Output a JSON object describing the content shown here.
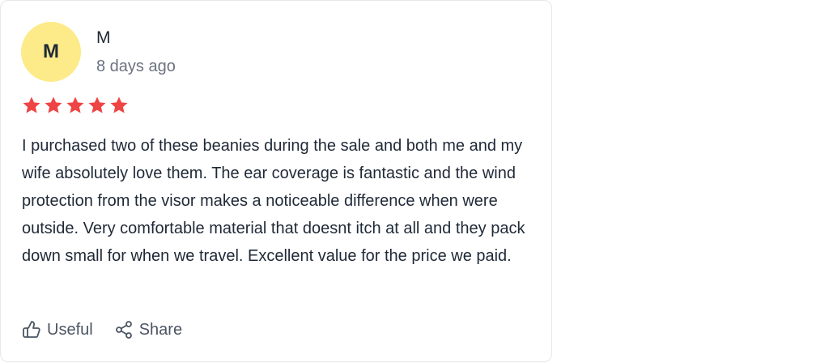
{
  "review": {
    "avatar_initial": "M",
    "author": "M",
    "date": "8 days ago",
    "rating": 5,
    "rating_max": 5,
    "body": "I purchased two of these beanies during the sale and both me and my wife absolutely love them. The ear coverage is fantastic and the wind protection from the visor makes a noticeable difference when were outside. Very comfortable material that doesnt itch at all and they pack down small for when we travel. Excellent value for the price we paid."
  },
  "actions": {
    "useful_label": "Useful",
    "useful_icon": "thumbs-up-icon",
    "share_label": "Share",
    "share_icon": "share-icon"
  },
  "colors": {
    "star": "#ef4444",
    "avatar_bg": "#fdeb8a",
    "text": "#1f2937",
    "muted": "#6b7280"
  }
}
